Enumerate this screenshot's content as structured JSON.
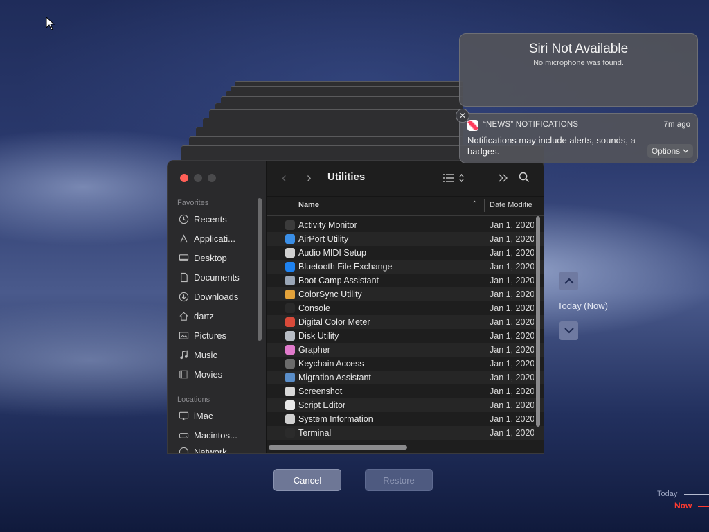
{
  "finder": {
    "title": "Utilities",
    "sidebar": {
      "favorites_label": "Favorites",
      "favorites": [
        {
          "label": "Recents",
          "icon": "clock-icon"
        },
        {
          "label": "Applicati...",
          "icon": "applications-icon"
        },
        {
          "label": "Desktop",
          "icon": "desktop-icon"
        },
        {
          "label": "Documents",
          "icon": "document-icon"
        },
        {
          "label": "Downloads",
          "icon": "download-icon"
        },
        {
          "label": "dartz",
          "icon": "home-icon"
        },
        {
          "label": "Pictures",
          "icon": "pictures-icon"
        },
        {
          "label": "Music",
          "icon": "music-icon"
        },
        {
          "label": "Movies",
          "icon": "movies-icon"
        }
      ],
      "locations_label": "Locations",
      "locations": [
        {
          "label": "iMac",
          "icon": "imac-icon"
        },
        {
          "label": "Macintos...",
          "icon": "disk-icon"
        },
        {
          "label": "Network",
          "icon": "network-icon"
        }
      ]
    },
    "columns": {
      "name": "Name",
      "date": "Date Modifie"
    },
    "files": [
      {
        "name": "Activity Monitor",
        "date": "Jan 1, 2020",
        "color": "#3b3b3b"
      },
      {
        "name": "AirPort Utility",
        "date": "Jan 1, 2020",
        "color": "#3a8ee6"
      },
      {
        "name": "Audio MIDI Setup",
        "date": "Jan 1, 2020",
        "color": "#d0d0d0"
      },
      {
        "name": "Bluetooth File Exchange",
        "date": "Jan 1, 2020",
        "color": "#1e82f0"
      },
      {
        "name": "Boot Camp Assistant",
        "date": "Jan 1, 2020",
        "color": "#9aa6b6"
      },
      {
        "name": "ColorSync Utility",
        "date": "Jan 1, 2020",
        "color": "#e3a23a"
      },
      {
        "name": "Console",
        "date": "Jan 1, 2020",
        "color": "#2a2a2a"
      },
      {
        "name": "Digital Color Meter",
        "date": "Jan 1, 2020",
        "color": "#d94a3a"
      },
      {
        "name": "Disk Utility",
        "date": "Jan 1, 2020",
        "color": "#b7bcc4"
      },
      {
        "name": "Grapher",
        "date": "Jan 1, 2020",
        "color": "#e07acb"
      },
      {
        "name": "Keychain Access",
        "date": "Jan 1, 2020",
        "color": "#6c6c6c"
      },
      {
        "name": "Migration Assistant",
        "date": "Jan 1, 2020",
        "color": "#5a8ec9"
      },
      {
        "name": "Screenshot",
        "date": "Jan 1, 2020",
        "color": "#d8d8d8"
      },
      {
        "name": "Script Editor",
        "date": "Jan 1, 2020",
        "color": "#e8e8e8"
      },
      {
        "name": "System Information",
        "date": "Jan 1, 2020",
        "color": "#cfcfcf"
      },
      {
        "name": "Terminal",
        "date": "Jan 1, 2020",
        "color": "#2b2b2b"
      }
    ]
  },
  "buttons": {
    "cancel": "Cancel",
    "restore": "Restore"
  },
  "timeline": {
    "current": "Today (Now)",
    "today": "Today",
    "now": "Now"
  },
  "siri": {
    "title": "Siri Not Available",
    "subtitle": "No microphone was found."
  },
  "news_notification": {
    "app": "“NEWS” NOTIFICATIONS",
    "time": "7m ago",
    "body": "Notifications may include alerts, sounds, and icon badges.",
    "body_visible": "Notifications may include alerts, sounds, a badges.",
    "options": "Options"
  },
  "colors": {
    "close": "#ff5f57",
    "now": "#ff3b30",
    "accent": "#6f7aa1"
  }
}
